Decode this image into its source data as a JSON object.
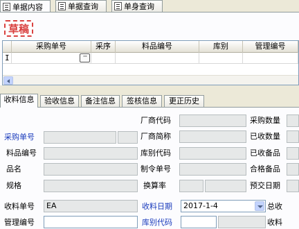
{
  "top_tabs": [
    {
      "label": "单据内容",
      "active": true
    },
    {
      "label": "单据查询",
      "active": false
    },
    {
      "label": "单身查询",
      "active": false
    }
  ],
  "draft_badge": "草稿",
  "grid": {
    "row_indicator": "I",
    "ellipsis": "···",
    "columns": [
      "采购单号",
      "采序",
      "料品编号",
      "库别",
      "管理编号"
    ]
  },
  "sub_tabs": [
    {
      "label": "收料信息",
      "active": true
    },
    {
      "label": "验收信息",
      "active": false
    },
    {
      "label": "备注信息",
      "active": false
    },
    {
      "label": "签核信息",
      "active": false
    },
    {
      "label": "更正历史",
      "active": false
    }
  ],
  "form": {
    "purchase_no_label": "采购单号",
    "item_no_label": "料品编号",
    "product_name_label": "品名",
    "spec_label": "规格",
    "vendor_code_label": "厂商代码",
    "vendor_abbr_label": "厂商简称",
    "warehouse_code_label": "库别代码",
    "manufacture_order_label": "制令单号",
    "conversion_rate_label": "换算率",
    "purchase_qty_label": "采购数量",
    "received_qty_label": "已收数量",
    "received_spares_label": "已收备品",
    "qualified_spares_label": "合格备品",
    "expected_date_label": "预交日期",
    "receipt_no_label": "收料单号",
    "receipt_no_value": "EA",
    "receipt_date_label": "收料日期",
    "receipt_date_value": "2017-1-4",
    "total_label": "总收",
    "mgmt_no_label": "管理编号",
    "warehouse_code2_label": "库别代码",
    "receive_label": "收料"
  },
  "colors": {
    "draft": "#d9403f",
    "blue_label": "#1a3bbc",
    "window_bg": "#ece9d8"
  }
}
